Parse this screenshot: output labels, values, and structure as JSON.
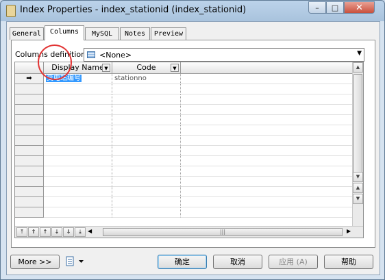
{
  "window": {
    "title": "Index Properties - index_stationid (index_stationid)",
    "minimize": "–",
    "maximize": "□",
    "close": "✕"
  },
  "tabs": [
    {
      "label": "General",
      "active": false
    },
    {
      "label": "Columns",
      "active": true
    },
    {
      "label": "MySQL",
      "active": false
    },
    {
      "label": "Notes",
      "active": false
    },
    {
      "label": "Preview",
      "active": false
    }
  ],
  "columns_definition": {
    "label": "Columns definition:",
    "value": "<None>"
  },
  "toolbar": {
    "icons": [
      "properties-icon",
      "add-columns-icon",
      "delete-icon",
      "find-icon",
      "filter-icon",
      "customize-columns-icon",
      "export-excel-icon",
      "print-icon",
      "dropdown-arrow-icon"
    ]
  },
  "grid": {
    "headers": [
      "Display Name",
      "Code"
    ],
    "rows": [
      {
        "current_marker": "➡",
        "display_name": "变电站编号",
        "code": "stationno"
      }
    ],
    "empty_rows": 13
  },
  "footer": {
    "more_label": "More >>",
    "ok_label": "确定",
    "cancel_label": "取消",
    "apply_label": "应用 (A)",
    "help_label": "帮助"
  },
  "colors": {
    "selection": "#3399ff",
    "annotation_circle": "#e23535"
  }
}
